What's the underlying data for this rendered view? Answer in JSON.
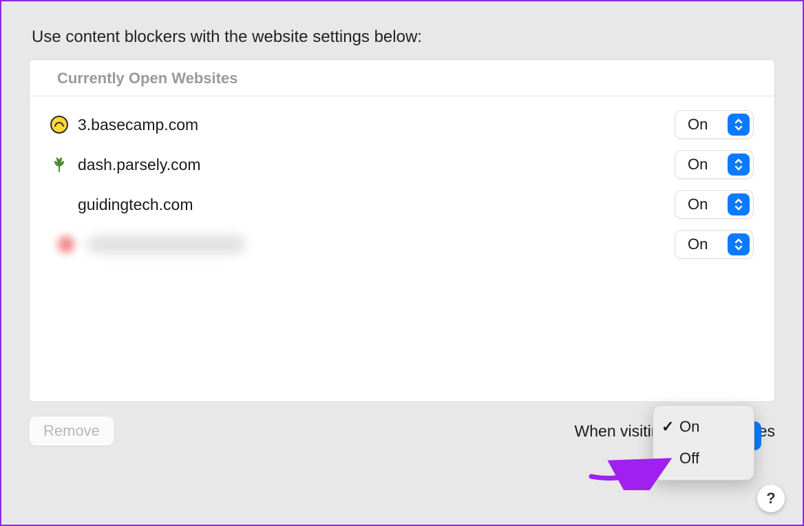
{
  "heading": "Use content blockers with the website settings below:",
  "panel": {
    "header": "Currently Open Websites",
    "rows": [
      {
        "icon": "basecamp",
        "site": "3.basecamp.com",
        "value": "On"
      },
      {
        "icon": "parsely",
        "site": "dash.parsely.com",
        "value": "On"
      },
      {
        "icon": "none",
        "site": "guidingtech.com",
        "value": "On"
      },
      {
        "icon": "redacted",
        "site": "",
        "value": "On"
      }
    ]
  },
  "remove_label": "Remove",
  "other_sites_label": "When visiting other websites",
  "other_sites_value": "On",
  "menu": {
    "options": [
      {
        "label": "On",
        "checked": true
      },
      {
        "label": "Off",
        "checked": false
      }
    ]
  },
  "help_label": "?"
}
